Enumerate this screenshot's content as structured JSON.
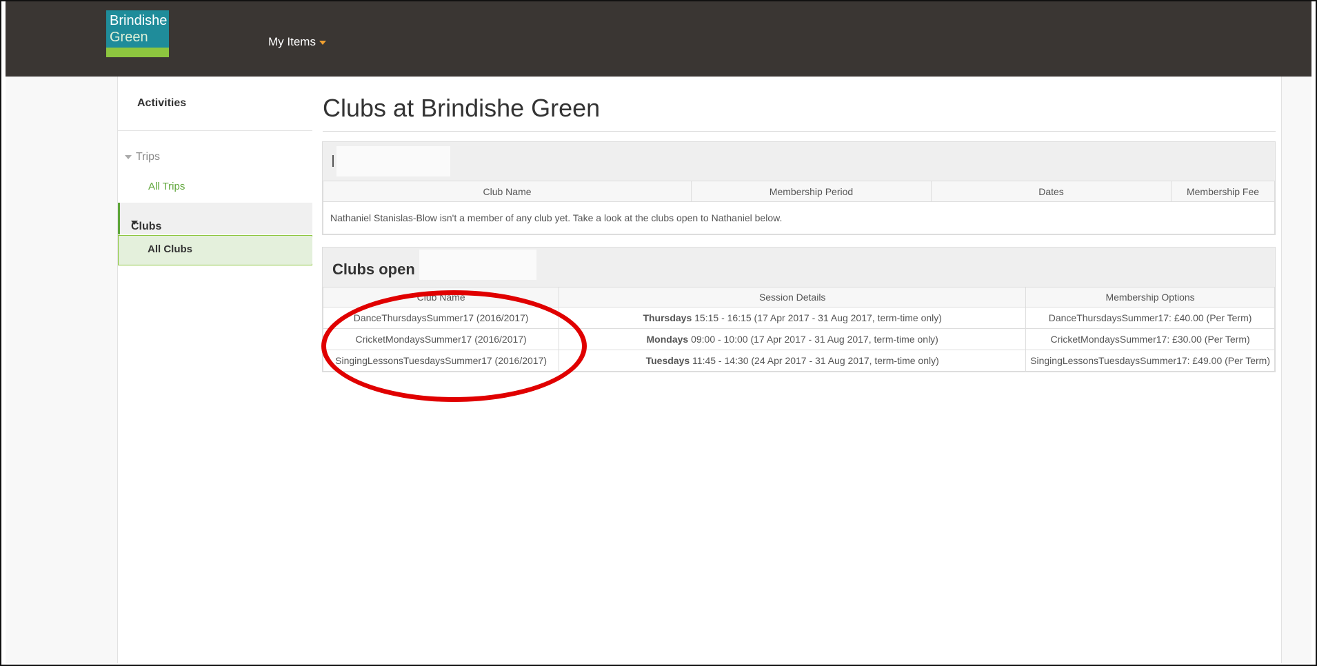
{
  "header": {
    "logo_line1": "Brindishe",
    "logo_line2": "Green",
    "my_items_label": "My Items"
  },
  "sidebar": {
    "title": "Activities",
    "trips_label": "Trips",
    "all_trips_label": "All Trips",
    "clubs_label": "Clubs",
    "all_clubs_label": "All Clubs"
  },
  "main": {
    "page_title": "Clubs at Brindishe Green",
    "memberships": {
      "columns": [
        "Club Name",
        "Membership Period",
        "Dates",
        "Membership Fee"
      ],
      "empty_message": "Nathaniel Stanislas-Blow isn't a member of any club yet. Take a look at the clubs open to Nathaniel below."
    },
    "open_clubs": {
      "title": "Clubs open to",
      "columns": [
        "Club Name",
        "Session Details",
        "Membership Options"
      ],
      "rows": [
        {
          "club": "DanceThursdaysSummer17 (2016/2017)",
          "day": "Thursdays",
          "session": "15:15 - 16:15 (17 Apr 2017 - 31 Aug 2017, term-time only)",
          "option": "DanceThursdaysSummer17: £40.00 (Per Term)"
        },
        {
          "club": "CricketMondaysSummer17 (2016/2017)",
          "day": "Mondays",
          "session": "09:00 - 10:00 (17 Apr 2017 - 31 Aug 2017, term-time only)",
          "option": "CricketMondaysSummer17: £30.00 (Per Term)"
        },
        {
          "club": "SingingLessonsTuesdaysSummer17 (2016/2017)",
          "day": "Tuesdays",
          "session": "11:45 - 14:30 (24 Apr 2017 - 31 Aug 2017, term-time only)",
          "option": "SingingLessonsTuesdaysSummer17: £49.00 (Per Term)"
        }
      ]
    }
  },
  "colors": {
    "topbar": "#3a3633",
    "accent_green": "#8dc63f",
    "logo_teal": "#1f8c9a",
    "annotation_red": "#e00000"
  }
}
